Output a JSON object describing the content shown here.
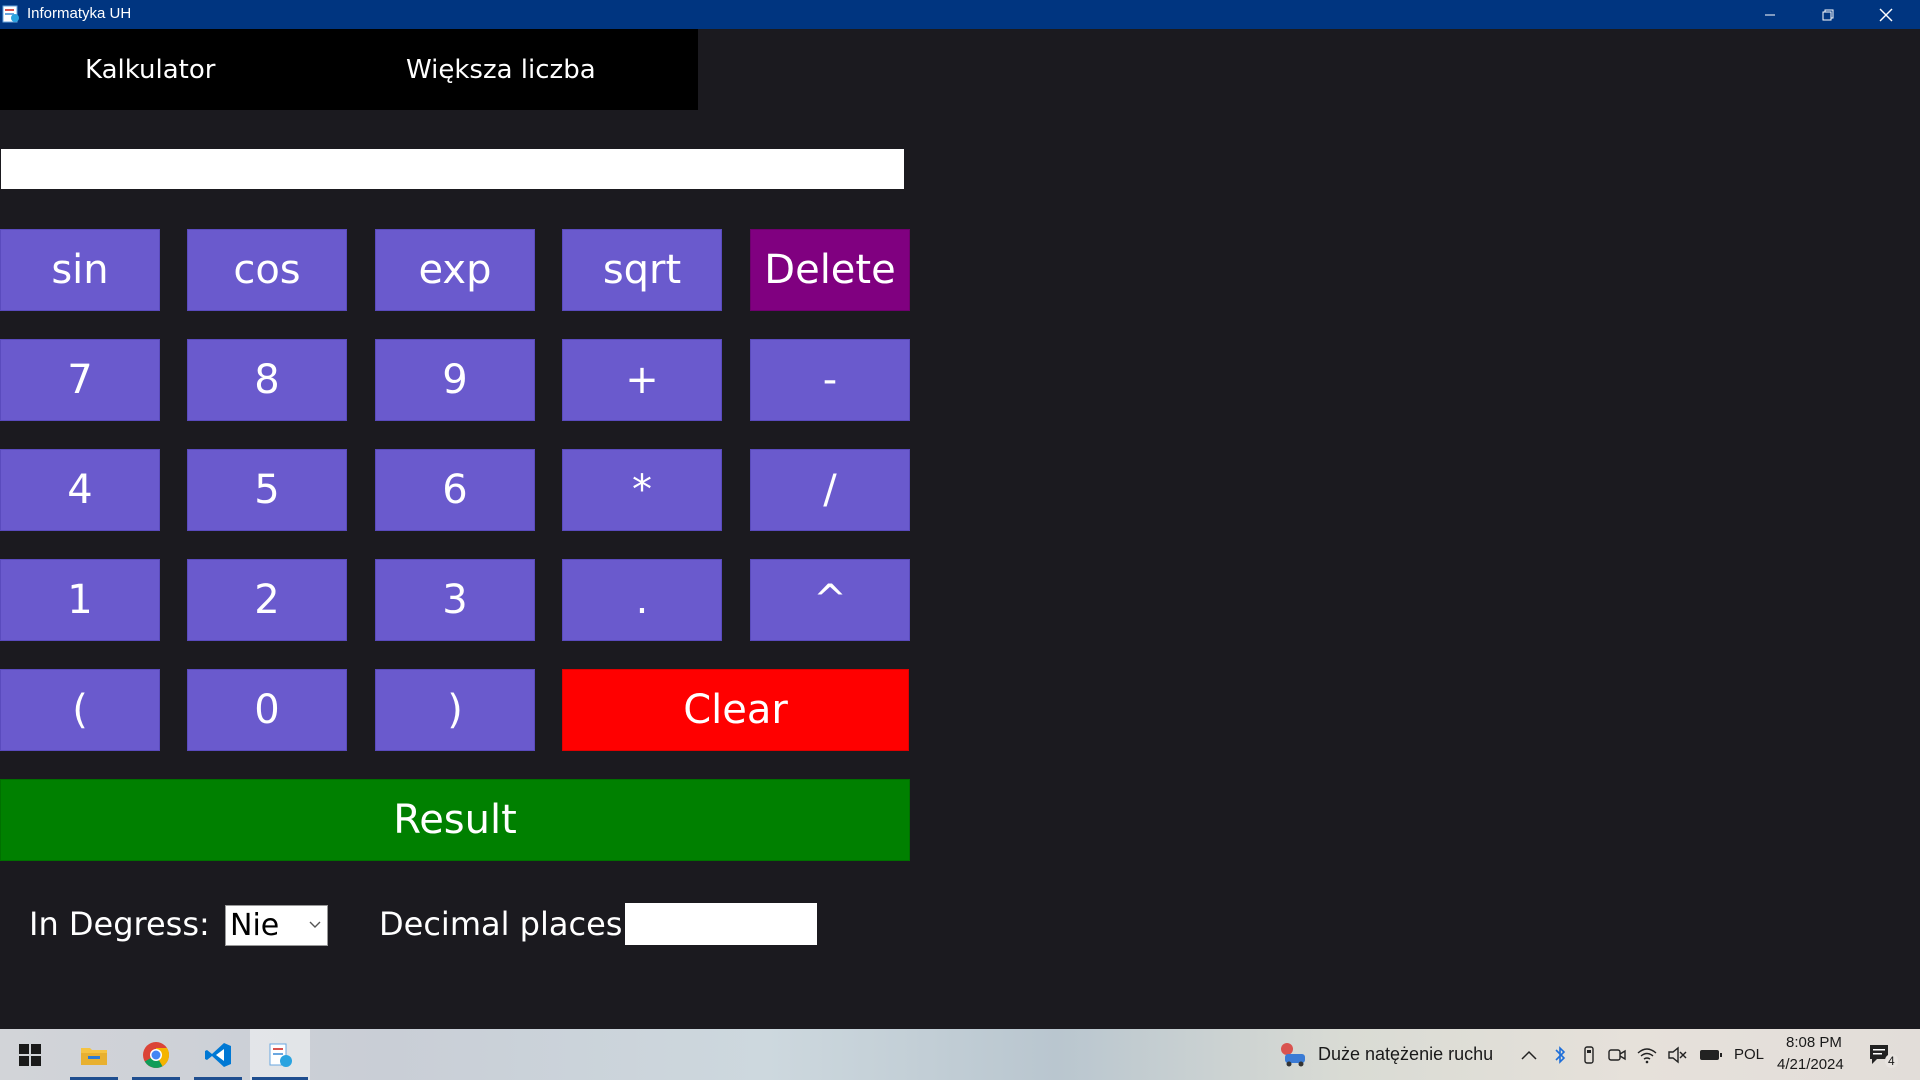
{
  "window": {
    "title": "Informatyka UH"
  },
  "tabs": [
    {
      "label": "Kalkulator"
    },
    {
      "label": "Większa liczba"
    }
  ],
  "expression": {
    "value": ""
  },
  "keys": {
    "row1": [
      "sin",
      "cos",
      "exp",
      "sqrt",
      "Delete"
    ],
    "row2": [
      "7",
      "8",
      "9",
      "+",
      "-"
    ],
    "row3": [
      "4",
      "5",
      "6",
      "*",
      "/"
    ],
    "row4": [
      "1",
      "2",
      "3",
      ".",
      "^"
    ],
    "row5": [
      "(",
      "0",
      ")",
      "Clear"
    ],
    "result": "Result"
  },
  "options": {
    "degrees_label": "In Degress:",
    "degrees_value": "Nie",
    "decimals_label": "Decimal places:",
    "decimals_value": ""
  },
  "taskbar": {
    "traffic_text": "Duże natężenie ruchu",
    "language": "POL",
    "time": "8:08 PM",
    "date": "4/21/2024",
    "notification_count": "4"
  },
  "colors": {
    "key": "#6a5acd",
    "delete": "#800080",
    "clear": "#ff0000",
    "result": "#008000",
    "titlebar": "#003580"
  }
}
